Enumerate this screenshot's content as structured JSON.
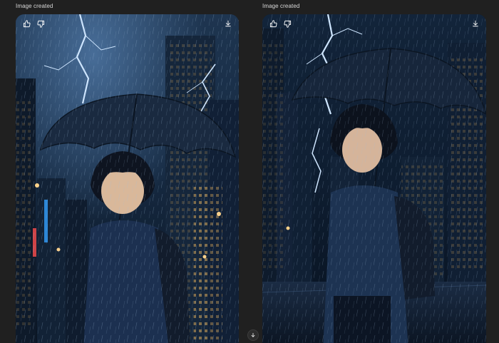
{
  "images": [
    {
      "caption": "Image created",
      "actions": {
        "like_icon": "thumbs-up-icon",
        "dislike_icon": "thumbs-down-icon",
        "download_icon": "download-icon"
      }
    },
    {
      "caption": "Image created",
      "actions": {
        "like_icon": "thumbs-up-icon",
        "dislike_icon": "thumbs-down-icon",
        "download_icon": "download-icon"
      }
    }
  ],
  "scroll": {
    "icon": "arrow-down-icon"
  },
  "colors": {
    "background": "#202020",
    "caption_text": "#d9d9d9",
    "icon": "#ffffff",
    "night_sky": "#0d1a2b",
    "lightning": "#cfe6ff"
  }
}
